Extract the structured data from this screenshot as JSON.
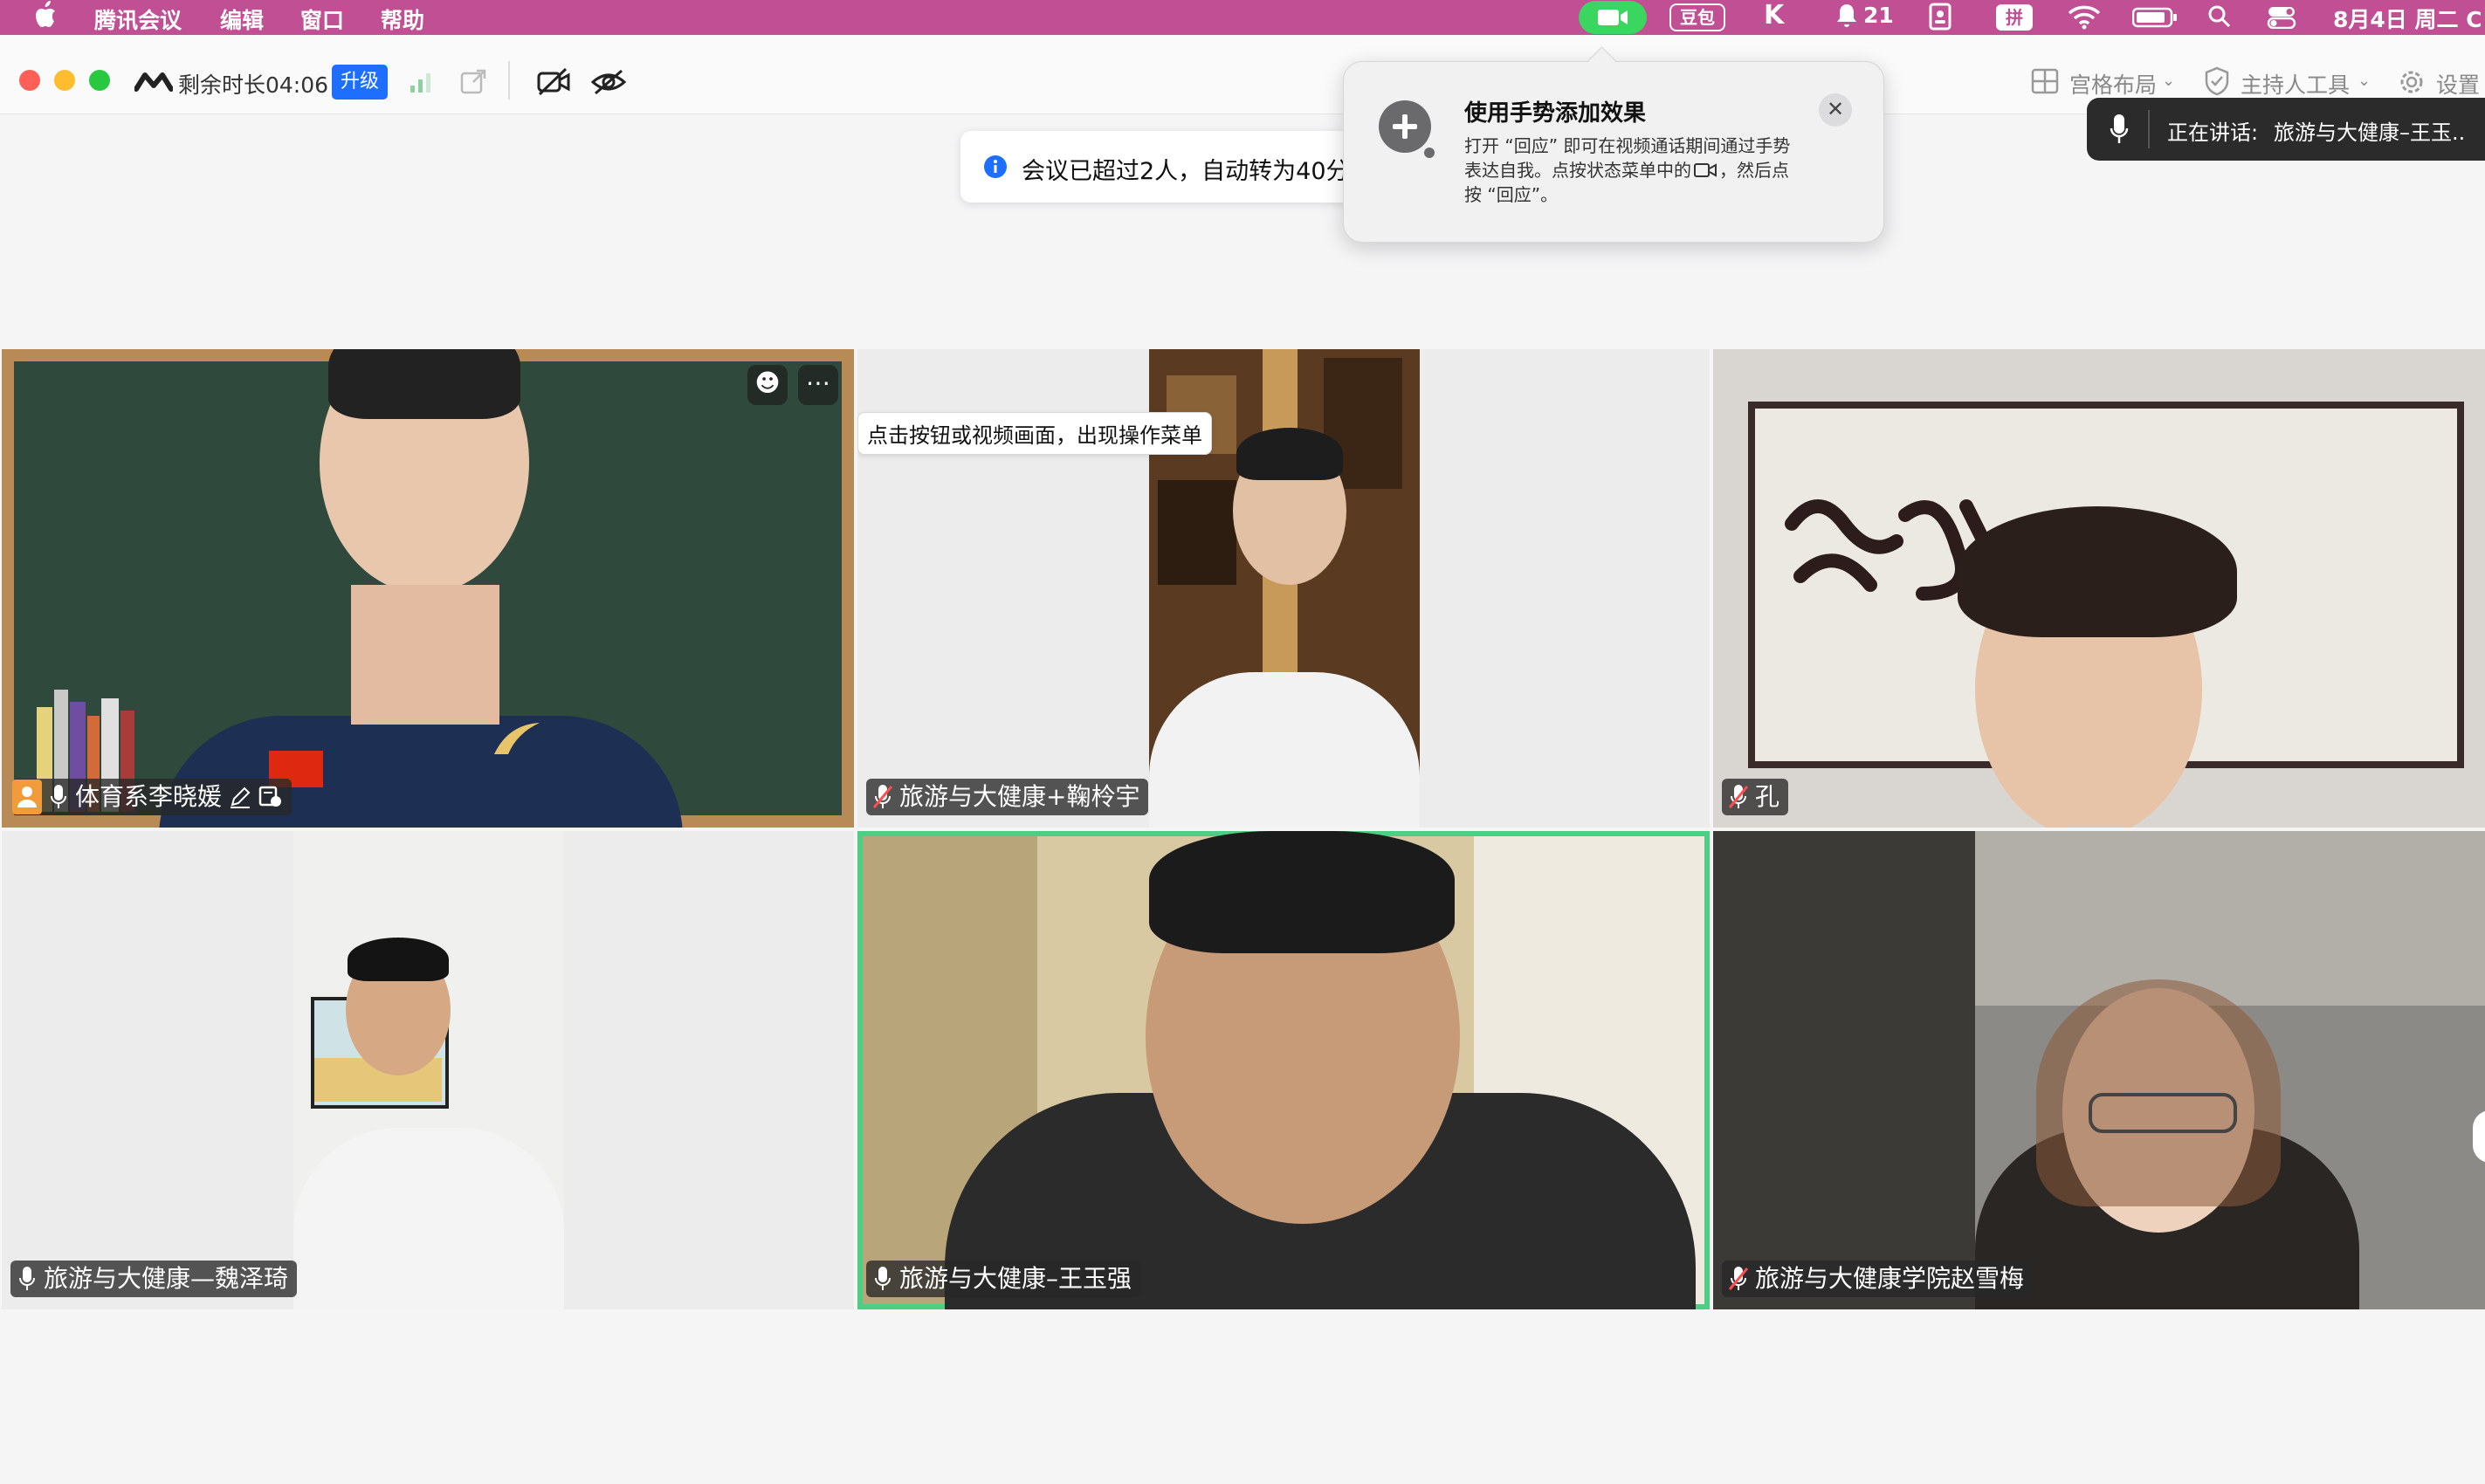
{
  "menubar": {
    "app_name": "腾讯会议",
    "menus": [
      "编辑",
      "窗口",
      "帮助"
    ],
    "doubao": "豆包",
    "k_icon": "K",
    "notification_count": "21",
    "input_method": "拼",
    "datetime": "8月4日 周二 C"
  },
  "toolbar": {
    "remaining_time": "剩余时长04:06",
    "upgrade_label": "升级",
    "grid_layout": "宫格布局",
    "host_tools": "主持人工具",
    "settings": "设置"
  },
  "notice": {
    "text": "会议已超过2人，自动转为40分"
  },
  "popover": {
    "title": "使用手势添加效果",
    "body_line1": "打开 “回应” 即可在视频通话期间通过手势",
    "body_line2": "表达自我。点按状态菜单中的",
    "body_line2b": "，然后点",
    "body_line3": "按 “回应”。"
  },
  "speaking": {
    "label": "正在讲话:",
    "name": "旅游与大健康–王玉.."
  },
  "tiles": [
    {
      "name": "体育系李晓媛",
      "mic": "on",
      "host": true
    },
    {
      "name": "旅游与大健康+鞠柃宇",
      "mic": "muted",
      "tooltip": "点击按钮或视频画面，出现操作菜单"
    },
    {
      "name": "孔",
      "mic": "muted"
    },
    {
      "name": "旅游与大健康—魏泽琦",
      "mic": "on"
    },
    {
      "name": "旅游与大健康–王玉强",
      "mic": "on",
      "active_speaker": true
    },
    {
      "name": "旅游与大健康学院赵雪梅",
      "mic": "muted"
    }
  ],
  "colors": {
    "menubar": "#c04f93",
    "accent_blue": "#1e6fff",
    "active_speaker_border": "#4ccf84",
    "facetime_green": "#3ad65f"
  }
}
